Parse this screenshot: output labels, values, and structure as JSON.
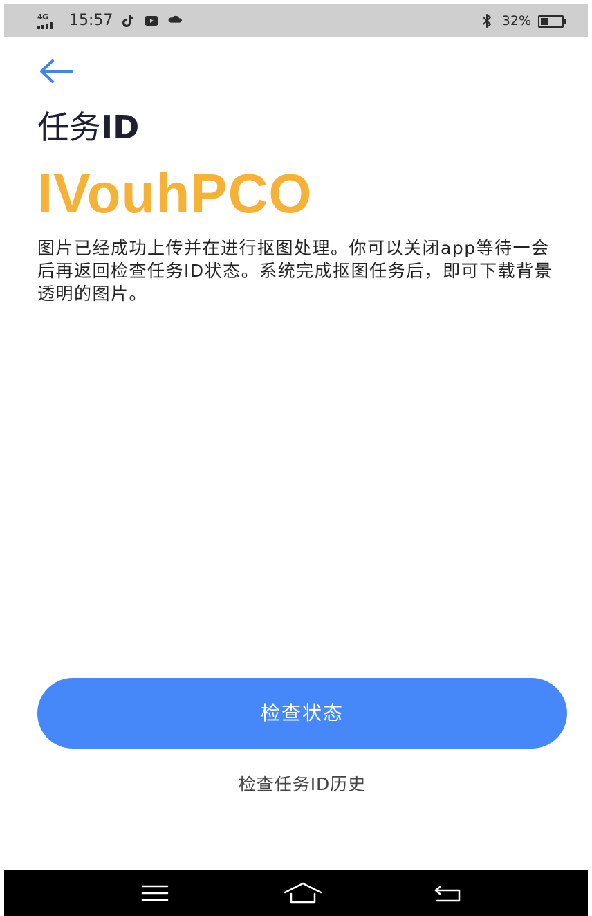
{
  "status_bar": {
    "network_type": "4G",
    "time": "15:57",
    "notification_icons": [
      "tiktok-icon",
      "youtube-icon",
      "cloud-icon"
    ],
    "bluetooth_icon": "bluetooth-icon",
    "battery_text": "32%",
    "battery_level": 0.32
  },
  "header": {
    "back_icon": "arrow-left-icon",
    "title_cn": "任务",
    "title_latin": "ID"
  },
  "main": {
    "task_id": "IVouhPCO",
    "description": "图片已经成功上传并在进行抠图处理。你可以关闭app等待一会后再返回检查任务ID状态。系统完成抠图任务后，即可下载背景透明的图片。"
  },
  "actions": {
    "check_status_label": "检查状态",
    "history_label": "检查任务ID历史"
  },
  "nav_bar": {
    "items": [
      "menu-icon",
      "home-icon",
      "back-icon"
    ]
  },
  "colors": {
    "accent_blue": "#4688fa",
    "task_id_orange": "#f6b236",
    "back_arrow_blue": "#3f86e6",
    "status_bar_bg": "#cfcfcf"
  }
}
